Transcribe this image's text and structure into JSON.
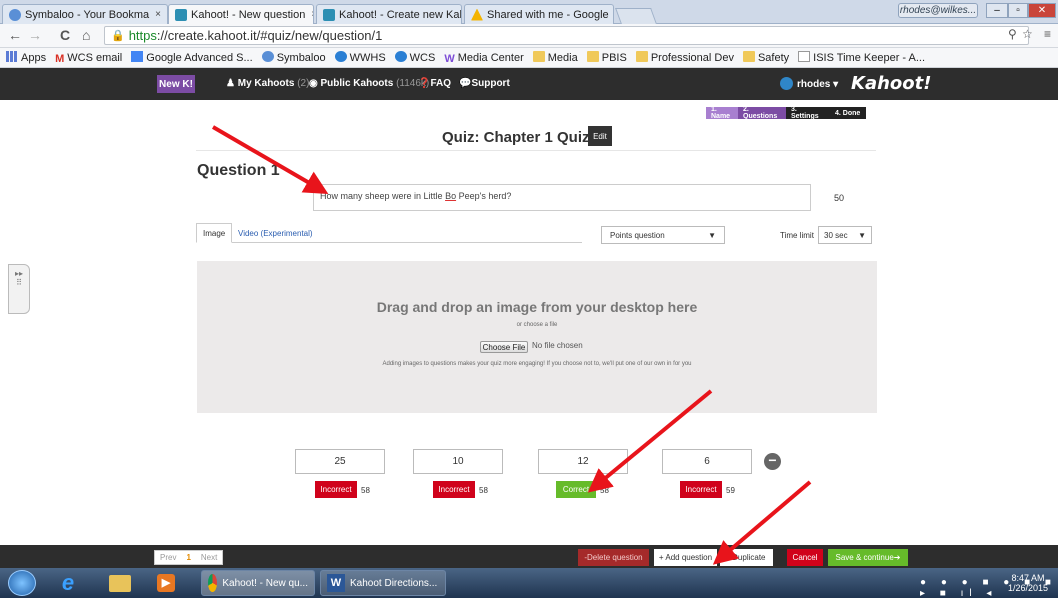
{
  "browser": {
    "tabs": [
      {
        "label": "Symbaloo - Your Bookma",
        "close": "×"
      },
      {
        "label": "Kahoot! - New question",
        "close": "×"
      },
      {
        "label": "Kahoot! - Create new Kah",
        "close": "×"
      },
      {
        "label": "Shared with me - Google",
        "close": "×"
      }
    ],
    "user_badge": "rhodes@wilkes...",
    "url_https": "https",
    "url_rest": "://create.kahoot.it/#quiz/new/question/1",
    "bookmarks": [
      "Apps",
      "WCS email",
      "Google Advanced S...",
      "Symbaloo",
      "WWHS",
      "WCS",
      "Media Center",
      "Media",
      "PBIS",
      "Professional Dev",
      "Safety",
      "ISIS Time Keeper - A..."
    ]
  },
  "kahoot_nav": {
    "new_k": "New K!",
    "my_kahoots": "My Kahoots",
    "my_kahoots_count": "(2)",
    "public_kahoots": "Public Kahoots",
    "public_count": "(1146k)",
    "faq": "FAQ",
    "support": "Support",
    "user": "rhodes",
    "logo": "Kahoot!"
  },
  "steps": [
    "1. Name",
    "2. Questions",
    "3. Settings",
    "4. Done"
  ],
  "quiz": {
    "title": "Quiz: Chapter 1 Quiz",
    "edit_label": "Edit",
    "question_label": "Question 1",
    "question_text_a": "How many sheep were in Little ",
    "question_text_u": "Bo",
    "question_text_b": " Peep's herd?",
    "char_count": "50",
    "media_tabs": [
      "Image",
      "Video (Experimental)"
    ],
    "points_select": "Points question",
    "time_limit_label": "Time limit",
    "time_limit_value": "30 sec"
  },
  "dropzone": {
    "heading": "Drag and drop an image from your desktop here",
    "or_choose": "or choose a file",
    "choose_button": "Choose File",
    "no_file": "No file chosen",
    "hint": "Adding images to questions makes your quiz more engaging! If you choose not to, we'll put one of our own in for you"
  },
  "answers": [
    {
      "value": "25",
      "status": "Incorrect",
      "score": "58"
    },
    {
      "value": "10",
      "status": "Incorrect",
      "score": "58"
    },
    {
      "value": "12",
      "status": "Correct",
      "score": "58"
    },
    {
      "value": "6",
      "status": "Incorrect",
      "score": "59"
    }
  ],
  "bottom": {
    "prev": "Prev",
    "page": "1",
    "next": "Next",
    "delete": "Delete question",
    "add": "+ Add question",
    "duplicate": "Duplicate",
    "cancel": "Cancel",
    "save": "Save & continue"
  },
  "taskbar": {
    "tasks": [
      "Kahoot! - New qu...",
      "Kahoot Directions..."
    ],
    "time": "8:47 AM",
    "date": "1/26/2015"
  },
  "colors": {
    "kahoot_purple": "#7c4ca4",
    "incorrect_red": "#d0021b",
    "correct_green": "#66bb2a",
    "arrow_red": "#e8141b"
  }
}
